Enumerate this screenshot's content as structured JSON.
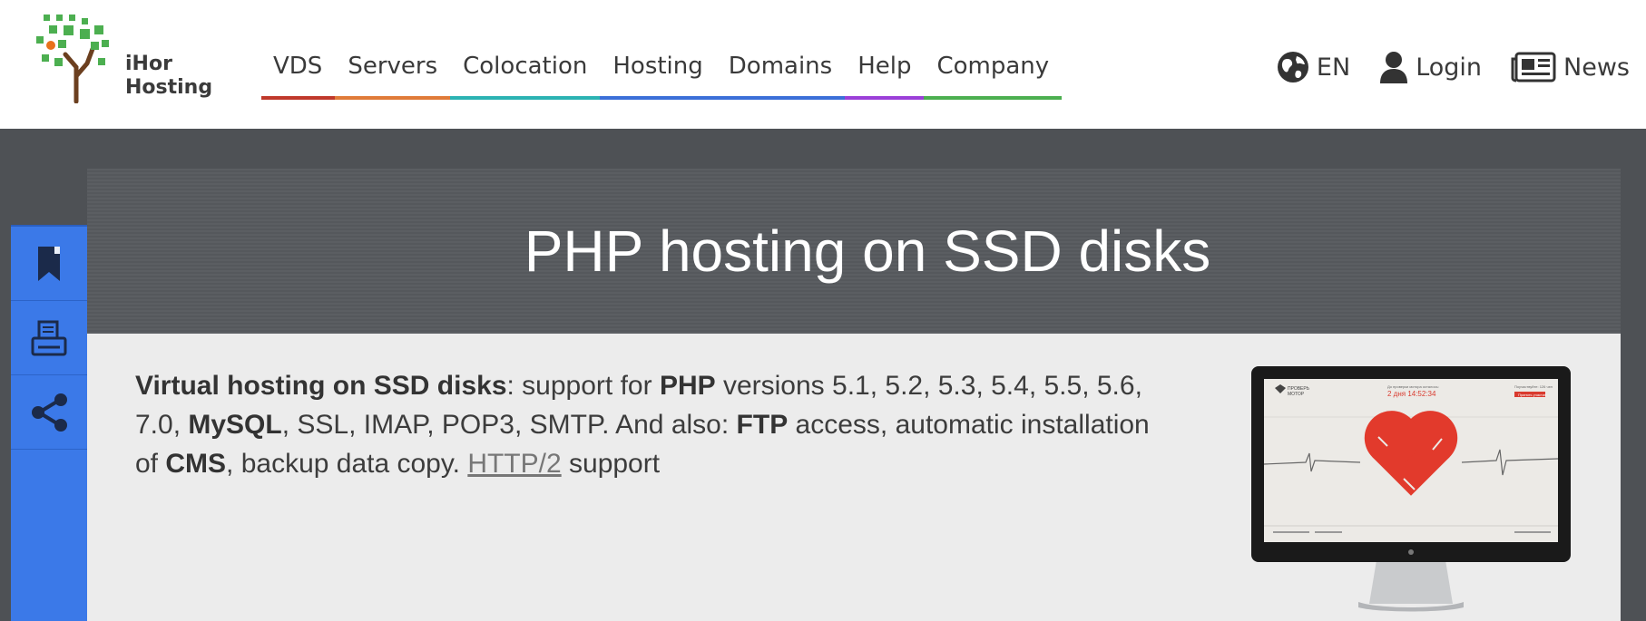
{
  "header": {
    "logo": {
      "line1": "iHor",
      "line2": "Hosting"
    },
    "nav": [
      {
        "label": "VDS",
        "color": "#c0392b"
      },
      {
        "label": "Servers",
        "color": "#e07b39"
      },
      {
        "label": "Colocation",
        "color": "#2bb3b3"
      },
      {
        "label": "Hosting",
        "color": "#3b6fd8"
      },
      {
        "label": "Domains",
        "color": "#3b6fd8"
      },
      {
        "label": "Help",
        "color": "#9b3fd8"
      },
      {
        "label": "Company",
        "color": "#4caf50"
      }
    ],
    "lang": {
      "label": "EN",
      "icon": "globe-icon"
    },
    "login": {
      "label": "Login",
      "icon": "user-icon"
    },
    "news": {
      "label": "News",
      "icon": "newspaper-icon"
    }
  },
  "sidebar": {
    "buttons": [
      {
        "icon": "bookmark-icon"
      },
      {
        "icon": "print-icon"
      },
      {
        "icon": "share-icon"
      }
    ],
    "color": "#3b79e8"
  },
  "main": {
    "title": "PHP hosting on SSD disks",
    "intro": {
      "s1_bold": "Virtual hosting on SSD disks",
      "s2": ": support for ",
      "s3_bold": "PHP",
      "s4": " versions 5.1, 5.2, 5.3, 5.4, 5.5, 5.6, 7.0, ",
      "s5_bold": "MySQL",
      "s6": ", SSL, IMAP, POP3, SMTP. And also: ",
      "s7_bold": "FTP",
      "s8": " access, automatic installation of ",
      "s9_bold": "CMS",
      "s10": ", backup data copy. ",
      "s11_link": "HTTP/2",
      "s12": " support"
    },
    "monitor": {
      "brand_line1": "ПРОВЕРЬ",
      "brand_line2": "МОТОР",
      "header_text": "До проверки мотора осталось:",
      "countdown": "2 дня 14:52:34",
      "corner_text": "Поучаствуйте: 126 чел",
      "cta": "Принять участие"
    }
  }
}
